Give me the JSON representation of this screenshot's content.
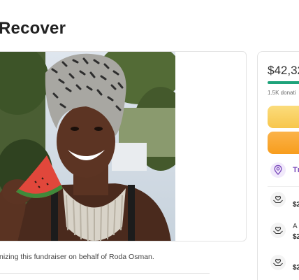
{
  "campaign": {
    "title": "Recover",
    "organizer_text": "nizing this fundraiser on behalf of Roda Osman."
  },
  "donate_panel": {
    "amount_raised": "$42,32",
    "progress_fraction": 0.95,
    "donations_count": "1.5K donati",
    "trending_label": "Tı",
    "donors": [
      {
        "name": "",
        "amount": "$2"
      },
      {
        "name": "A",
        "amount": "$2"
      },
      {
        "name": "",
        "amount": "$2"
      }
    ]
  },
  "colors": {
    "accent_green": "#1ea37b",
    "share_yellow": "#f7c64c",
    "donate_orange": "#f79d1d",
    "trending_purple": "#7c4dbd"
  },
  "icons": {
    "trending": "location-pin-icon",
    "donor": "heart-hands-icon"
  }
}
